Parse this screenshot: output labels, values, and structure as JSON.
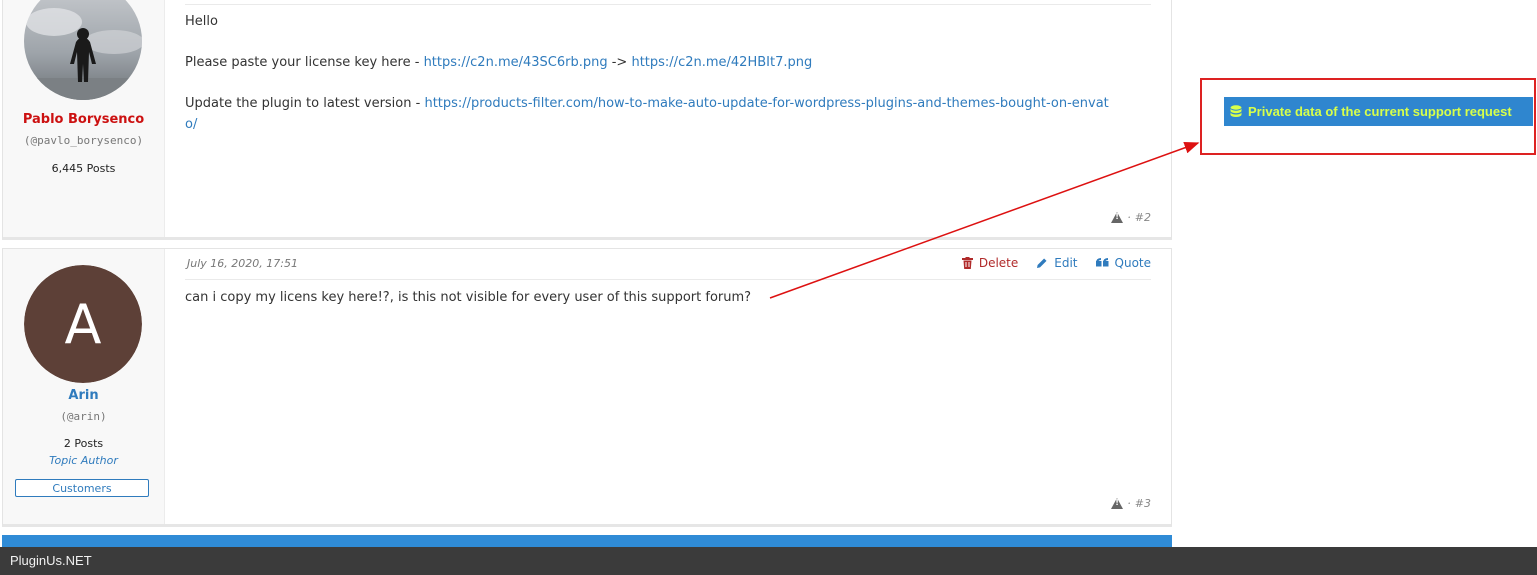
{
  "replies": [
    {
      "author": {
        "name": "Pablo Borysenco",
        "handle": "(@pavlo_borysenco)",
        "posts": "6,445 Posts",
        "name_color": "#cc1111"
      },
      "paragraphs": [
        {
          "text": "Hello"
        },
        {
          "text": "Please paste your license key here - ",
          "link1": "https://c2n.me/43SC6rb.png",
          "sep": " -> ",
          "link2": "https://c2n.me/42HBIt7.png"
        },
        {
          "text": "Update  the  plugin to latest  version  - ",
          "link1": "https://products-filter.com/how-to-make-auto-update-for-wordpress-plugins-and-themes-bought-on-envato/"
        }
      ],
      "number": "#2"
    },
    {
      "date": "July 16, 2020, 17:51",
      "actions": {
        "delete": "Delete",
        "edit": "Edit",
        "quote": "Quote"
      },
      "author": {
        "name": "Arin",
        "avatar_letter": "A",
        "avatar_color": "#5d4037",
        "handle": "(@arin)",
        "posts": "2 Posts",
        "role": "Topic Author",
        "badge": "Customers",
        "name_color": "#2f7bbd"
      },
      "paragraphs": [
        {
          "text": "can i copy my licens key here!?, is this not visible for every user of this support forum?"
        }
      ],
      "number": "#3"
    }
  ],
  "report_sep": "·",
  "private_button": {
    "label": "Private data of the current support request",
    "icon": "database-icon",
    "text_color": "#d8ff4a",
    "bg": "#2f86cf"
  },
  "annotation": {
    "color": "#dd1111"
  },
  "footer": {
    "text": "PluginUs.NET"
  }
}
